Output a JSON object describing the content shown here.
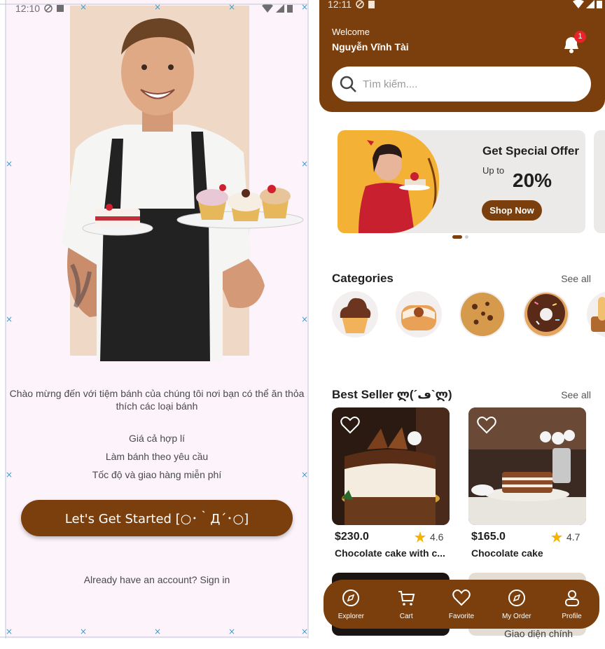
{
  "left": {
    "status_time": "12:10",
    "welcome_message": "Chào mừng đến với tiệm bánh của chúng tôi nơi bạn có thể ăn thỏa thích các loại bánh",
    "features": [
      "Giá cả hợp lí",
      "Làm bánh theo yêu cầu",
      "Tốc độ và giao hàng miễn phí"
    ],
    "start_button": "Let's Get Started [○･｀Д´･○]",
    "signin_text": "Already have an account? Sign in"
  },
  "right": {
    "status_time": "12:11",
    "welcome_label": "Welcome",
    "user_name": "Nguyễn Vĩnh Tài",
    "notification_count": "1",
    "search_placeholder": "Tìm kiếm....",
    "promo": {
      "title": "Get Special Offer",
      "up_to": "Up to",
      "percent": "20%",
      "button": "Shop Now"
    },
    "categories": {
      "title": "Categories",
      "see_all": "See all",
      "items": [
        "cupcake-icon",
        "cinnamon-roll-icon",
        "cookie-icon",
        "donut-icon",
        "bread-icon"
      ]
    },
    "best_seller": {
      "title": "Best Seller ლ(´ڡ`ლ)",
      "see_all": "See all",
      "products": [
        {
          "price": "$230.0",
          "rating": "4.6",
          "name": "Chocolate cake with c..."
        },
        {
          "price": "$165.0",
          "rating": "4.7",
          "name": "Chocolate cake"
        }
      ]
    },
    "nav": [
      {
        "label": "Explorer",
        "icon": "compass-icon"
      },
      {
        "label": "Cart",
        "icon": "cart-icon"
      },
      {
        "label": "Favorite",
        "icon": "heart-icon"
      },
      {
        "label": "My Order",
        "icon": "compass-icon"
      },
      {
        "label": "Profile",
        "icon": "profile-icon"
      }
    ],
    "overlay_text": "Giao diện chính"
  },
  "colors": {
    "brand_brown": "#7a3f0c",
    "left_background": "#fcf3fb",
    "badge_red": "#e8242a",
    "star_yellow": "#f5b400"
  }
}
